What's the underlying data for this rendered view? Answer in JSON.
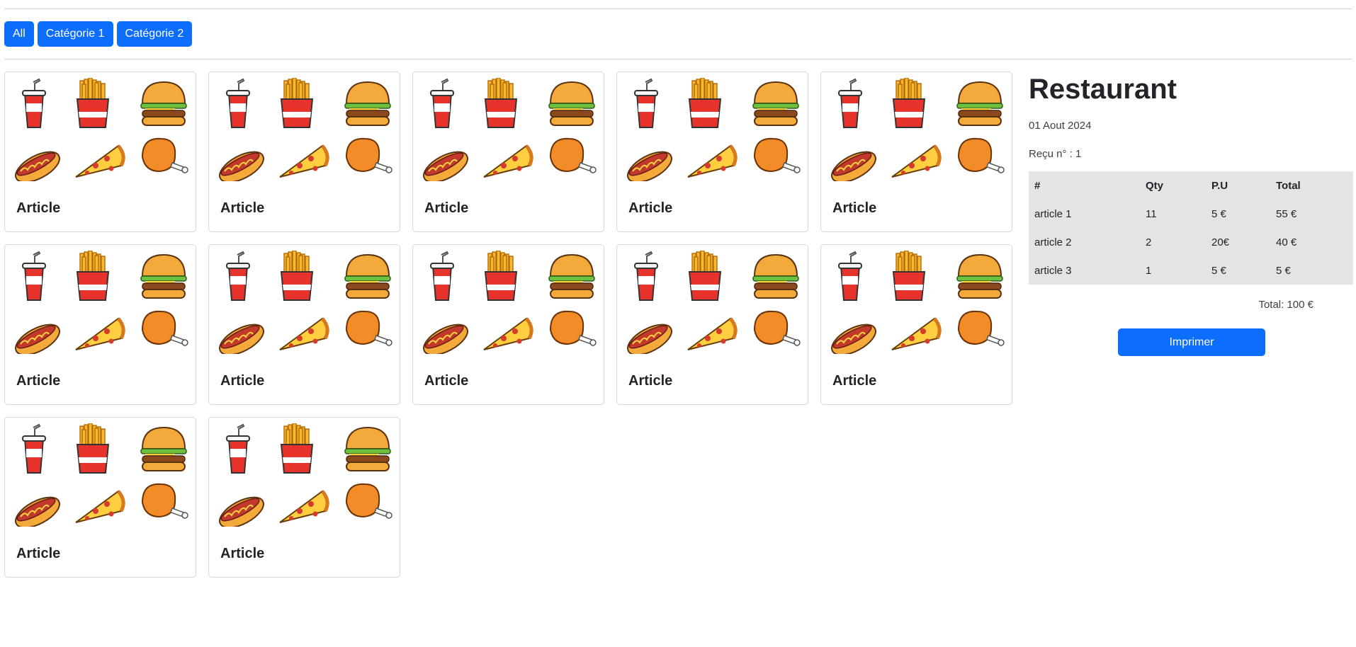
{
  "filters": [
    "All",
    "Catégorie 1",
    "Catégorie 2"
  ],
  "articles": [
    {
      "title": "Article"
    },
    {
      "title": "Article"
    },
    {
      "title": "Article"
    },
    {
      "title": "Article"
    },
    {
      "title": "Article"
    },
    {
      "title": "Article"
    },
    {
      "title": "Article"
    },
    {
      "title": "Article"
    },
    {
      "title": "Article"
    },
    {
      "title": "Article"
    },
    {
      "title": "Article"
    },
    {
      "title": "Article"
    }
  ],
  "article_image_icons": [
    "soda-cup-icon",
    "french-fries-icon",
    "burger-icon",
    "hotdog-icon",
    "pizza-slice-icon",
    "fried-chicken-icon"
  ],
  "receipt": {
    "title": "Restaurant",
    "date": "01 Aout 2024",
    "number": "Reçu n° : 1",
    "columns": [
      "#",
      "Qty",
      "P.U",
      "Total"
    ],
    "rows": [
      [
        "article 1",
        "11",
        "5 €",
        "55 €"
      ],
      [
        "article 2",
        "2",
        "20€",
        "40 €"
      ],
      [
        "article 3",
        "1",
        "5 €",
        "5 €"
      ]
    ],
    "total": "Total: 100 €",
    "print_label": "Imprimer"
  },
  "colors": {
    "primary": "#0d6efd",
    "table_bg": "#e3e4e5",
    "card_border": "#d6d8da"
  }
}
